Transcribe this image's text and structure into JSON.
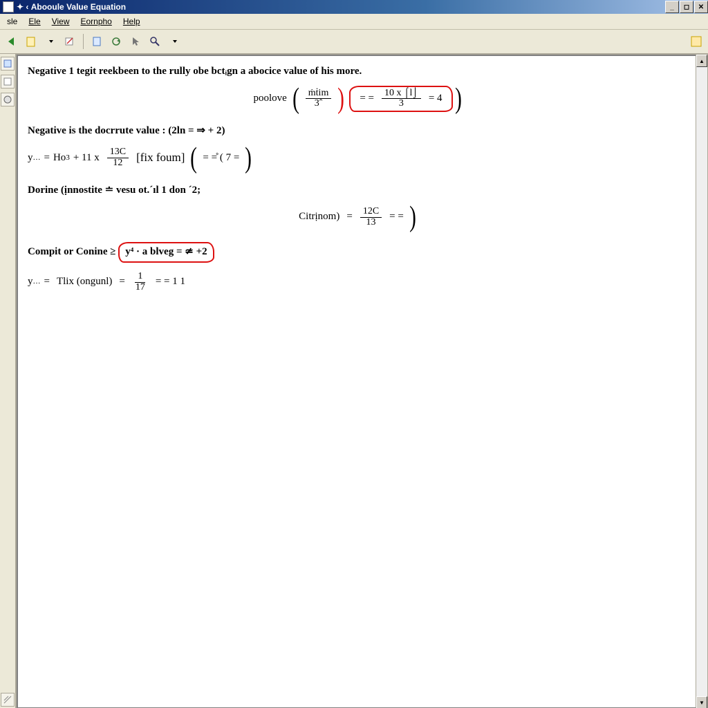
{
  "window": {
    "title_prefix": "✦ ‹",
    "title": "Abooule Value  Equation",
    "buttons": {
      "minimize": "_",
      "restore": "◻",
      "close": "✕"
    }
  },
  "menu": {
    "items": [
      "sle",
      "Ele",
      "View",
      "Eornpho",
      "Help"
    ]
  },
  "toolbar": {
    "icons": [
      "back-arrow",
      "new-doc",
      "dropdown",
      "convert",
      "page",
      "refresh",
      "pointer",
      "zoom"
    ],
    "right_icon": "help-box"
  },
  "sidebar": {
    "icons": [
      "tool-a",
      "tool-b",
      "tool-c"
    ]
  },
  "doc": {
    "line1": "Negative 1 tegit reekbeen to the rully obe bctᵢgn a abocice value of his more.",
    "eq1": {
      "prefix": "poolove",
      "frac1_num": "ṁṫim",
      "frac1_den": "3ˆ",
      "mid": "=   =",
      "frac2_num": "10  x  ⌠l⌡",
      "frac2_den": "3",
      "tail": "= 4"
    },
    "line2_a": "Negative is the docrrute value :",
    "line2_b": "(2ln  =  ⇒ + 2)",
    "eq2": {
      "lhs_y": "y",
      "lhs_sub": "…",
      "lhs_eq": "=",
      "Ho": "Ho",
      "Ho_sup": "3",
      "plus11x": "+ 11 x",
      "frac_num": "13C",
      "frac_den": "12",
      "fixfoum": "[fix foum]",
      "paren_inner": "=  =̊  ( 7 ="
    },
    "line3": "Dorine (ịnnostite ≐ vesu ot.´ıl 1 don ´2;",
    "eq3": {
      "lhs": "Citrịnom)",
      "eq": "=",
      "frac_num": "12C",
      "frac_den": "13",
      "tail": "=  ="
    },
    "line4_a": "Compit or Conine ≥",
    "line4_b": "y⁴ ·  a blveg  =  ≄  +2",
    "eq4": {
      "lhs_y": "y",
      "lhs_sub": "…",
      "lhs_eq": "=",
      "Tlix": "Tlix (ongunl)",
      "eq2": "=",
      "frac_num": "1",
      "frac_den": "17",
      "tail": "=  =  1  1"
    }
  },
  "statusbar": {
    "left_icon": "corner"
  }
}
